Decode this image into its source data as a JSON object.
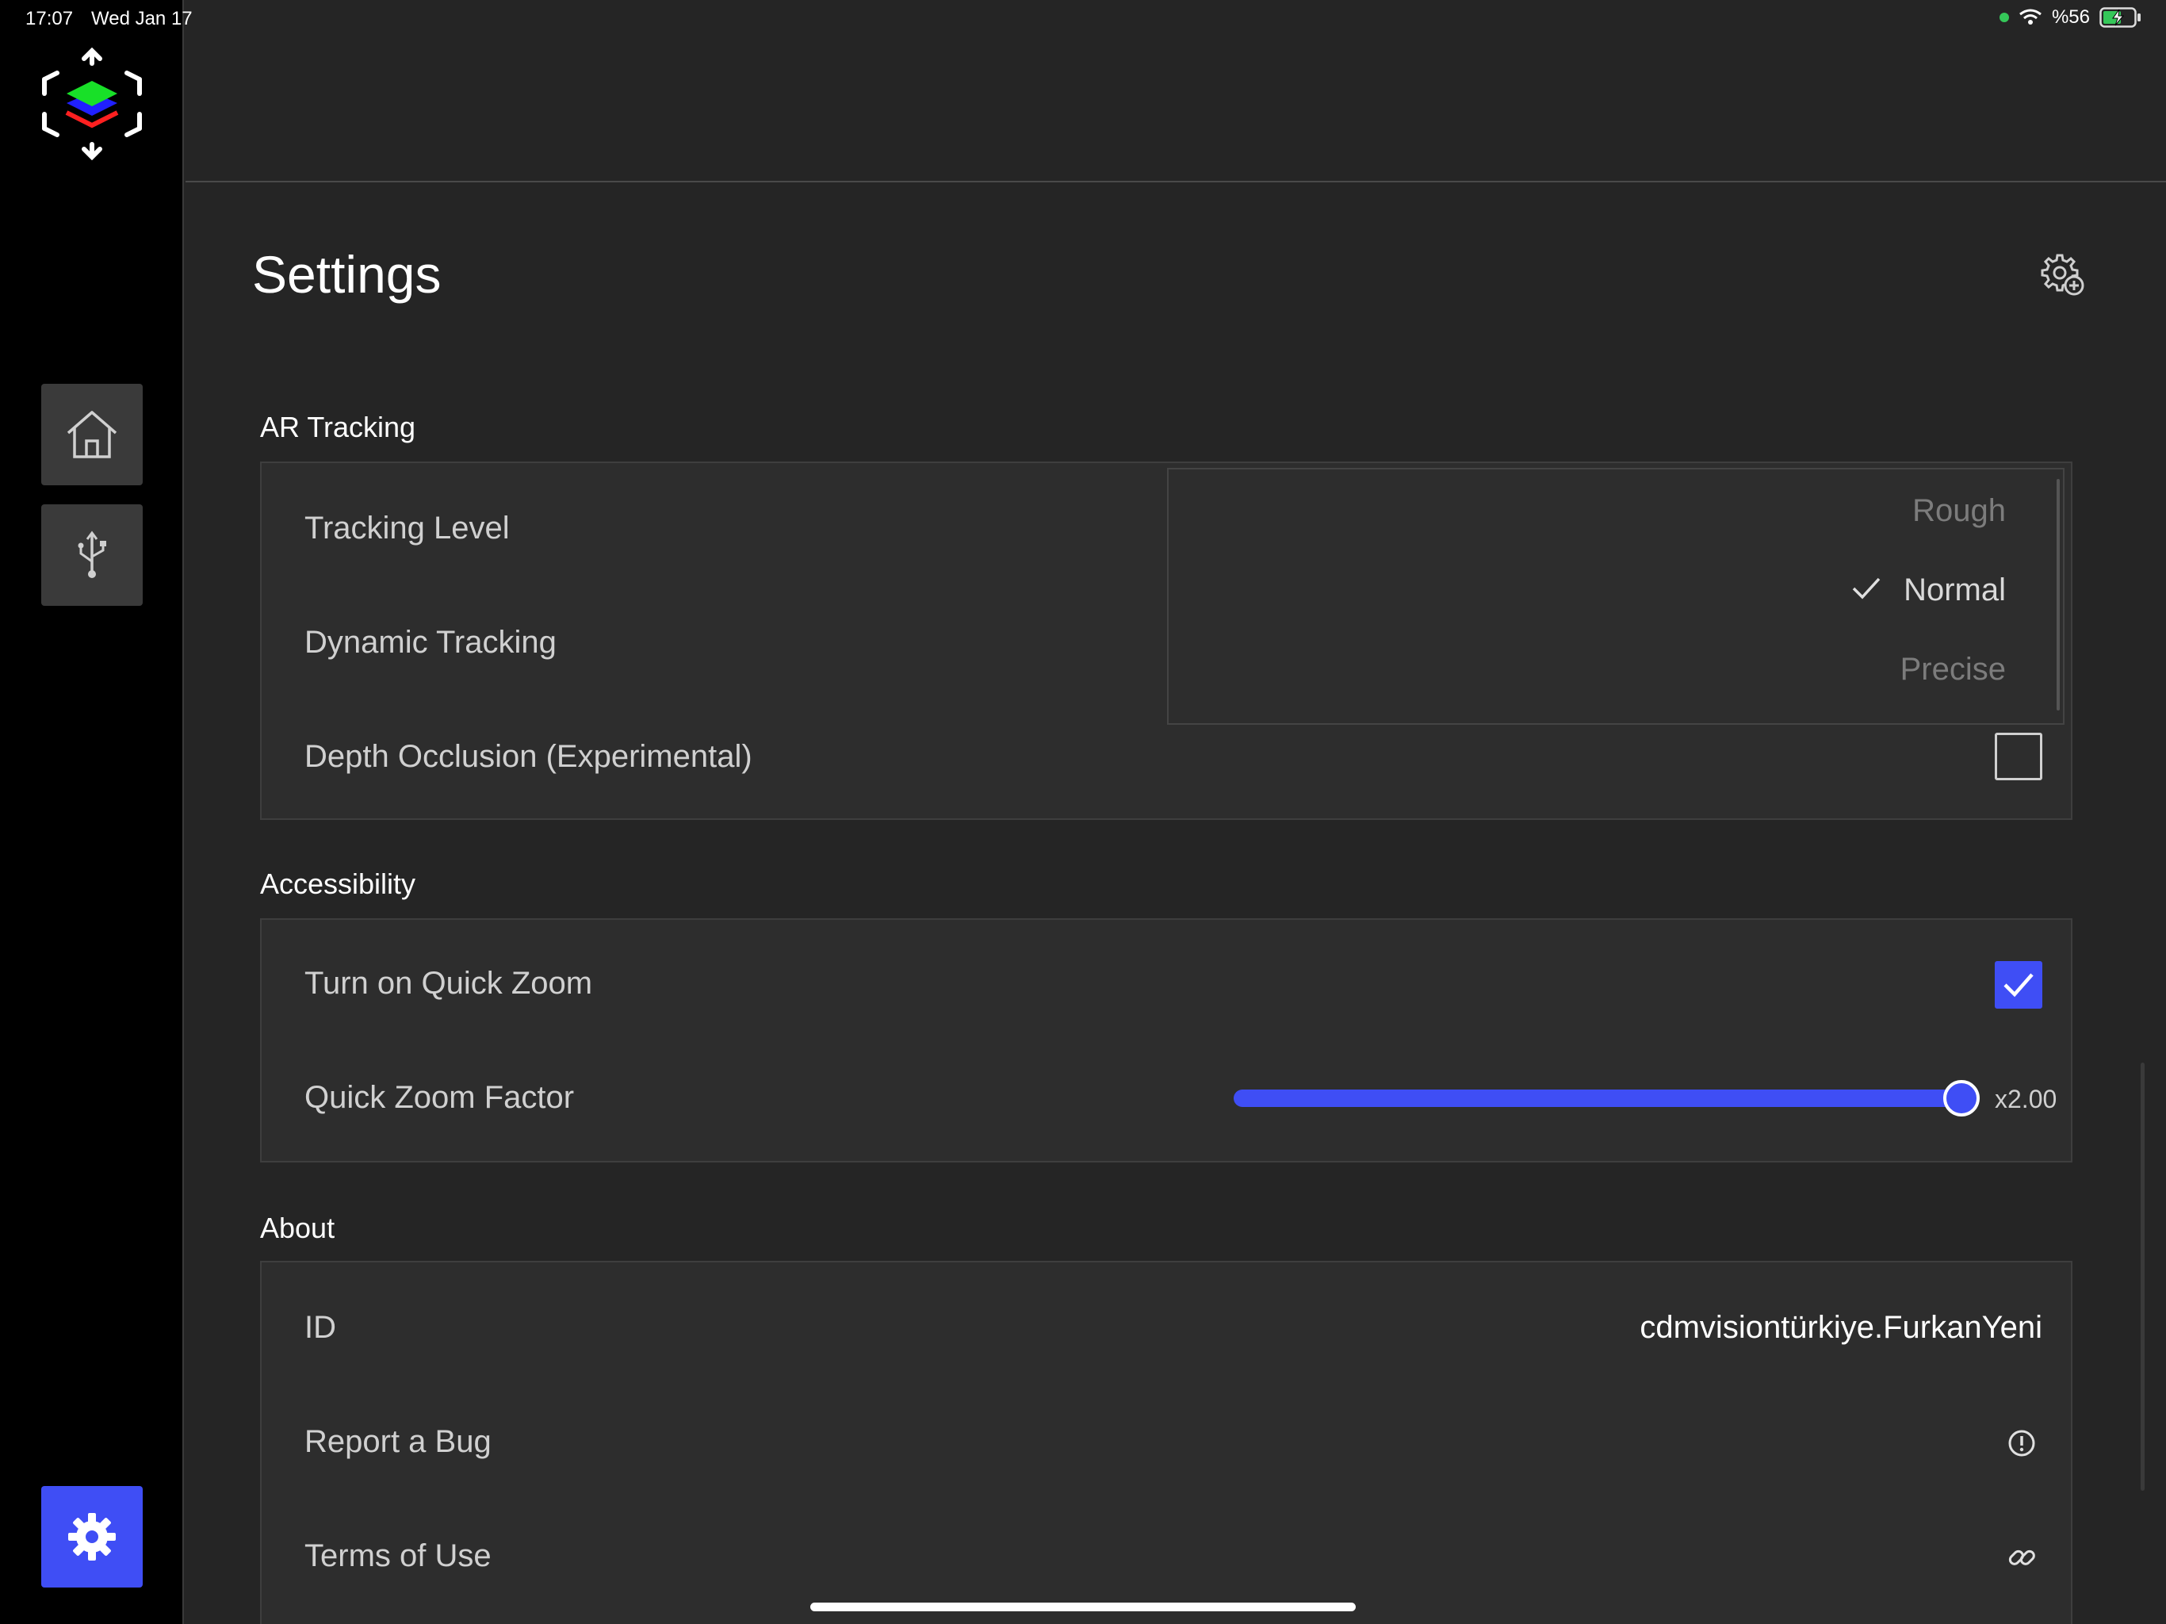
{
  "status_bar": {
    "time": "17:07",
    "date": "Wed Jan 17",
    "battery": "%56",
    "icons": [
      "green-dot-indicator",
      "wifi-icon",
      "battery-charging-icon"
    ]
  },
  "sidebar": {
    "logo_icon": "layered-cube-logo",
    "items": [
      {
        "icon": "home-icon",
        "active": false
      },
      {
        "icon": "usb-icon",
        "active": false
      },
      {
        "icon": "gear-icon",
        "active": true
      }
    ]
  },
  "page": {
    "title": "Settings",
    "action_icon": "gear-plus-icon"
  },
  "sections": {
    "ar_tracking": {
      "label": "AR Tracking",
      "tracking_level": {
        "label": "Tracking Level",
        "options": [
          "Rough",
          "Normal",
          "Precise"
        ],
        "selected": "Normal"
      },
      "dynamic_tracking": {
        "label": "Dynamic Tracking"
      },
      "depth_occlusion": {
        "label": "Depth Occlusion (Experimental)",
        "checked": false
      }
    },
    "accessibility": {
      "label": "Accessibility",
      "quick_zoom": {
        "label": "Turn on Quick Zoom",
        "checked": true
      },
      "quick_zoom_factor": {
        "label": "Quick Zoom Factor",
        "value_label": "x2.00",
        "fraction": 1.0
      }
    },
    "about": {
      "label": "About",
      "id": {
        "label": "ID",
        "value": "cdmvisiontürkiye.FurkanYeni"
      },
      "report_bug": {
        "label": "Report a Bug",
        "icon": "info-circle-icon"
      },
      "terms": {
        "label": "Terms of Use",
        "icon": "link-icon"
      }
    }
  },
  "colors": {
    "accent": "#3f4ef5",
    "background": "#252525",
    "card": "#2d2d2d",
    "sidebar": "#000000"
  }
}
